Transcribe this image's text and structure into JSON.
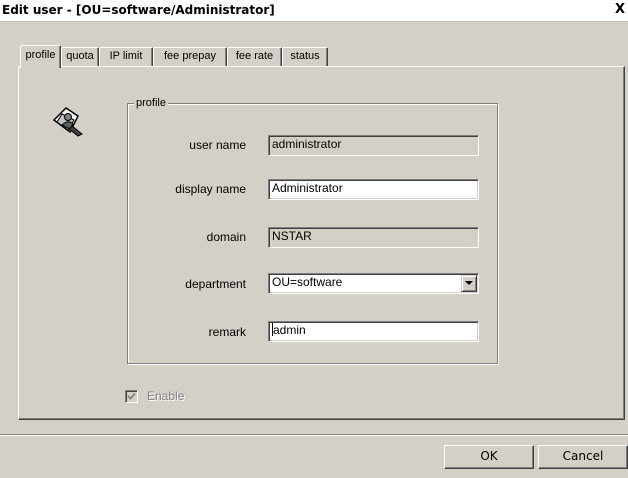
{
  "window": {
    "title": "Edit user - [OU=software/Administrator]",
    "close_glyph": "X"
  },
  "tabs": [
    {
      "label": "profile",
      "active": true
    },
    {
      "label": "quota",
      "active": false
    },
    {
      "label": "IP limit",
      "active": false
    },
    {
      "label": "fee prepay",
      "active": false
    },
    {
      "label": "fee rate",
      "active": false
    },
    {
      "label": "status",
      "active": false
    }
  ],
  "profile": {
    "group_label": "profile",
    "icon": "user-edit-icon",
    "fields": {
      "user_name": {
        "label": "user name",
        "value": "administrator"
      },
      "display_name": {
        "label": "display name",
        "value": "Administrator"
      },
      "domain": {
        "label": "domain",
        "value": "NSTAR"
      },
      "department": {
        "label": "department",
        "value": "OU=software"
      },
      "remark": {
        "label": "remark",
        "value": "admin"
      }
    }
  },
  "enable": {
    "label": "Enable",
    "checked": true,
    "disabled": true
  },
  "buttons": {
    "ok": "OK",
    "cancel": "Cancel"
  }
}
